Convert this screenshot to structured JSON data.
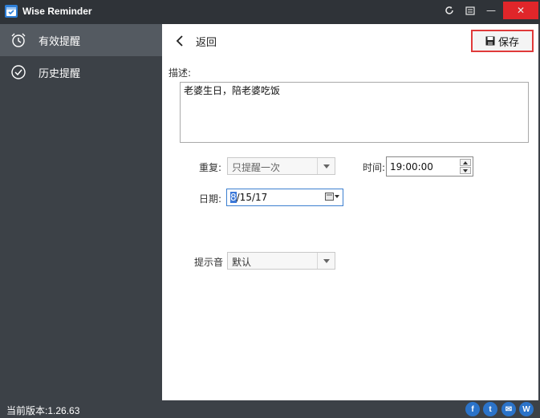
{
  "titlebar": {
    "app_title": "Wise Reminder",
    "close_symbol": "✕",
    "minimize_symbol": "—"
  },
  "sidebar": {
    "items": [
      {
        "label": "有效提醒",
        "icon": "alarm-clock-icon",
        "active": true
      },
      {
        "label": "历史提醒",
        "icon": "check-circle-icon",
        "active": false
      }
    ]
  },
  "main": {
    "back_label": "返回",
    "save_label": "保存",
    "description_label": "描述:",
    "description_value": "老婆生日，陪老婆吃饭",
    "repeat_label": "重复:",
    "repeat_value": "只提醒一次",
    "time_label": "时间:",
    "time_value": "19:00:00",
    "date_label": "日期:",
    "date_value_selected": "8",
    "date_value_rest": "/15/17",
    "sound_label": "提示音",
    "sound_value": "默认"
  },
  "statusbar": {
    "version": "当前版本:1.26.63",
    "social": [
      {
        "icon": "facebook-icon",
        "glyph": "f"
      },
      {
        "icon": "twitter-icon",
        "glyph": "t"
      },
      {
        "icon": "email-icon",
        "glyph": "✉"
      },
      {
        "icon": "wisecleaner-icon",
        "glyph": "W"
      }
    ]
  },
  "colors": {
    "sidebar_bg": "#3c4147",
    "sidebar_active": "#545a61",
    "close_red": "#e0262a",
    "highlight_border": "#e03a3a",
    "accent_blue": "#2b73c9"
  }
}
